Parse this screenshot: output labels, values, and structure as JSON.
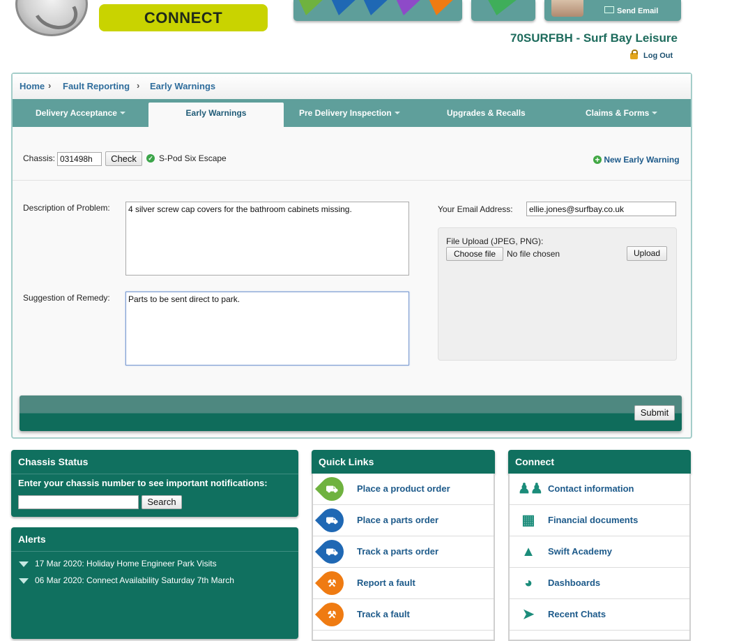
{
  "header": {
    "brand_label": "CONNECT",
    "site_title": "70SURFBH - Surf Bay Leisure",
    "logout_label": "Log Out",
    "send_email_label": "Send Email"
  },
  "breadcrumb": [
    "Home",
    "Fault Reporting",
    "Early Warnings"
  ],
  "tabs": [
    {
      "label": "Delivery Acceptance"
    },
    {
      "label": "Early Warnings"
    },
    {
      "label": "Pre Delivery Inspection"
    },
    {
      "label": "Upgrades & Recalls"
    },
    {
      "label": "Claims & Forms"
    }
  ],
  "chassis_form": {
    "label": "Chassis:",
    "value": "031498h",
    "check_label": "Check",
    "model_name": "S-Pod Six Escape",
    "new_warning_label": "New Early Warning"
  },
  "problem_form": {
    "description_label": "Description of Problem:",
    "description_value": "4 silver screw cap covers for the bathroom cabinets missing.",
    "remedy_label": "Suggestion of Remedy:",
    "remedy_value": "Parts to be sent direct to park.",
    "email_label": "Your Email Address:",
    "email_value": "ellie.jones@surfbay.co.uk",
    "upload_label": "File Upload (JPEG, PNG):",
    "choose_file_label": "Choose file",
    "no_file_label": "No file chosen",
    "upload_button_label": "Upload",
    "submit_label": "Submit"
  },
  "chassis_status": {
    "title": "Chassis Status",
    "prompt": "Enter your chassis number to see important notifications:",
    "search_value": "",
    "search_label": "Search"
  },
  "alerts": {
    "title": "Alerts",
    "items": [
      "17 Mar 2020: Holiday Home Engineer Park Visits",
      "06 Mar 2020: Connect Availability Saturday 7th March"
    ]
  },
  "quick_links": {
    "title": "Quick Links",
    "items": [
      {
        "label": "Place a product order",
        "icon": "caravan-icon",
        "color": "#6fb23f"
      },
      {
        "label": "Place a parts order",
        "icon": "truck-icon",
        "color": "#1f68b4"
      },
      {
        "label": "Track a parts order",
        "icon": "truck-icon",
        "color": "#1f68b4"
      },
      {
        "label": "Report a fault",
        "icon": "tools-icon",
        "color": "#ef7b12"
      },
      {
        "label": "Track a fault",
        "icon": "tools-icon",
        "color": "#ef7b12"
      }
    ]
  },
  "connect_links": {
    "title": "Connect",
    "items": [
      {
        "label": "Contact information",
        "icon": "people-icon"
      },
      {
        "label": "Financial documents",
        "icon": "calculator-icon"
      },
      {
        "label": "Swift Academy",
        "icon": "academy-icon"
      },
      {
        "label": "Dashboards",
        "icon": "gauge-icon"
      },
      {
        "label": "Recent Chats",
        "icon": "megaphone-icon"
      }
    ]
  },
  "colors": {
    "teal": "#10705f",
    "tab_bar": "#5f9f9b",
    "brand_lime": "#c9d300",
    "link_blue": "#1d5a8a"
  }
}
